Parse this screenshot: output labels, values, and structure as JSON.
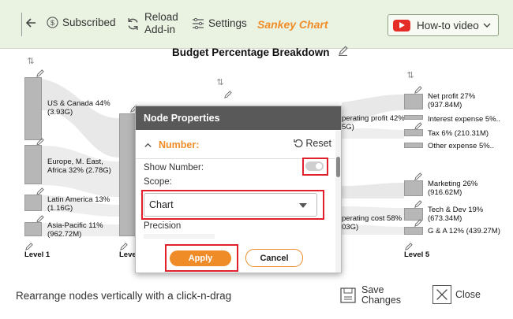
{
  "toolbar": {
    "subscribed_label": "Subscribed",
    "reload_line1": "Reload",
    "reload_line2": "Add-in",
    "settings_label": "Settings",
    "app_title": "Sankey Chart",
    "howto_label": "How-to video"
  },
  "chart": {
    "title": "Budget Percentage Breakdown",
    "nodes_level1": [
      {
        "line1": "US & Canada 44%",
        "line2": "(3.93G)"
      },
      {
        "line1": "Europe, M. East,",
        "line2": "Africa 32% (2.78G)"
      },
      {
        "line1": "Latin America 13%",
        "line2": "(1.16G)"
      },
      {
        "line1": "Asia-Pacific 11%",
        "line2": "(962.72M)"
      }
    ],
    "nodes_level3": [
      {
        "line1": "perating profit 42%",
        "line2": "5G)"
      },
      {
        "line1": "perating cost 58%",
        "line2": "03G)"
      }
    ],
    "nodes_level5": [
      {
        "line1": "Net profit 27%",
        "line2": "(937.84M)"
      },
      {
        "line1": "Interest expense 5%..",
        "line2": ""
      },
      {
        "line1": "Tax 6% (210.31M)",
        "line2": ""
      },
      {
        "line1": "Other expense 5%..",
        "line2": ""
      },
      {
        "line1": "Marketing 26%",
        "line2": "(916.62M)"
      },
      {
        "line1": "Tech & Dev 19%",
        "line2": "(673.34M)"
      },
      {
        "line1": "G & A 12% (439.27M)",
        "line2": ""
      }
    ],
    "level1_label": "Level 1",
    "level2_label": "Leve",
    "level5_label": "Level 5"
  },
  "dialog": {
    "title": "Node Properties",
    "section_title": "Number:",
    "reset_label": "Reset",
    "show_number_label": "Show Number:",
    "show_number_on": false,
    "scope_label": "Scope:",
    "scope_value": "Chart",
    "precision_label": "Precision",
    "apply_label": "Apply",
    "cancel_label": "Cancel"
  },
  "footer": {
    "message": "Rearrange nodes vertically with a click-n-drag",
    "save_line1": "Save",
    "save_line2": "Changes",
    "close_label": "Close"
  },
  "colors": {
    "toolbar_bg": "#eaf3e2",
    "accent_orange": "#f08c28",
    "highlight_red": "#e0202a",
    "dialog_header": "#595959",
    "node_gray": "#b7b7b7"
  }
}
